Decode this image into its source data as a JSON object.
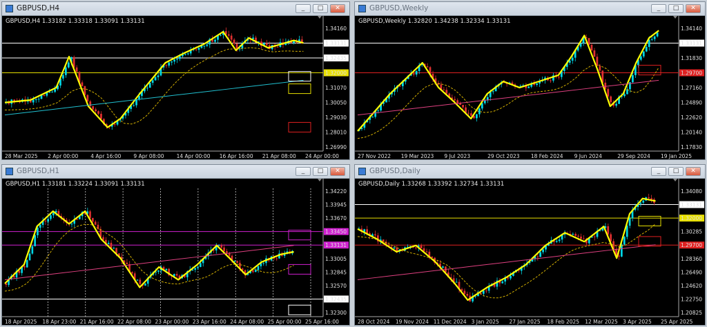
{
  "windows": [
    {
      "id": "h4",
      "title": "GBPUSD,H4",
      "info": "GBPUSD,H4  1.33182 1.33318 1.33091 1.33131",
      "active": true,
      "price_labels": [
        "1.34160",
        "1.33131",
        "1.32435",
        "1.32000",
        "1.31070",
        "1.30050",
        "1.29030",
        "1.28010",
        "1.26990"
      ],
      "time_labels": [
        "28 Mar 2025",
        "2 Apr 00:00",
        "4 Apr 16:00",
        "9 Apr 08:00",
        "14 Apr 00:00",
        "16 Apr 16:00",
        "21 Apr 08:00",
        "24 Apr 00:00"
      ],
      "highlighted": [
        "1.33131",
        "1.32435",
        "1.32000",
        "1.29700"
      ]
    },
    {
      "id": "weekly",
      "title": "GBPUSD,Weekly",
      "info": "GBPUSD,Weekly  1.32820 1.34238 1.32334 1.33131",
      "active": false,
      "price_labels": [
        "1.34140",
        "1.33131",
        "1.31830",
        "1.29700",
        "1.27160",
        "1.24890",
        "1.22620",
        "1.20140",
        "1.17830"
      ],
      "time_labels": [
        "27 Nov 2022",
        "19 Mar 2023",
        "9 Jul 2023",
        "29 Oct 2023",
        "18 Feb 2024",
        "9 Jun 2024",
        "29 Sep 2024",
        "19 Jan 2025"
      ],
      "highlighted": [
        "1.33131",
        "1.29700"
      ]
    },
    {
      "id": "h1",
      "title": "GBPUSD,H1",
      "info": "GBPUSD,H1  1.33181 1.33224 1.33091 1.33131",
      "active": false,
      "price_labels": [
        "1.34220",
        "1.33945",
        "1.33670",
        "1.33450",
        "1.33131",
        "1.33005",
        "1.32845",
        "1.32570",
        "1.32435",
        "1.32300"
      ],
      "time_labels": [
        "18 Apr 2025",
        "18 Apr 23:00",
        "21 Apr 16:00",
        "22 Apr 08:00",
        "23 Apr 00:00",
        "23 Apr 16:00",
        "24 Apr 08:00",
        "25 Apr 00:00",
        "25 Apr 16:00"
      ],
      "highlighted": [
        "1.33450",
        "1.33131",
        "1.32435"
      ]
    },
    {
      "id": "daily",
      "title": "GBPUSD,Daily",
      "info": "GBPUSD,Daily  1.33268 1.33392 1.32734 1.33131",
      "active": false,
      "price_labels": [
        "1.34080",
        "1.33131",
        "1.32000",
        "1.30285",
        "1.29700",
        "1.28360",
        "1.26490",
        "1.24620",
        "1.22750",
        "1.20825"
      ],
      "time_labels": [
        "28 Oct 2024",
        "19 Nov 2024",
        "11 Dec 2024",
        "3 Jan 2025",
        "27 Jan 2025",
        "18 Feb 2025",
        "12 Mar 2025",
        "3 Apr 2025",
        "25 Apr 2025"
      ],
      "highlighted": [
        "1.33131",
        "1.32000",
        "1.29700"
      ]
    }
  ],
  "colors": {
    "bull": "#00d7e6",
    "bear": "#e03030",
    "zigzag": "#ffff00",
    "level_yellow": "#e8e000",
    "level_red": "#e02020",
    "level_white": "#ffffff",
    "level_magenta": "#d020d0"
  },
  "window_buttons": {
    "minimize": "_",
    "maximize": "□",
    "close": "✕"
  }
}
